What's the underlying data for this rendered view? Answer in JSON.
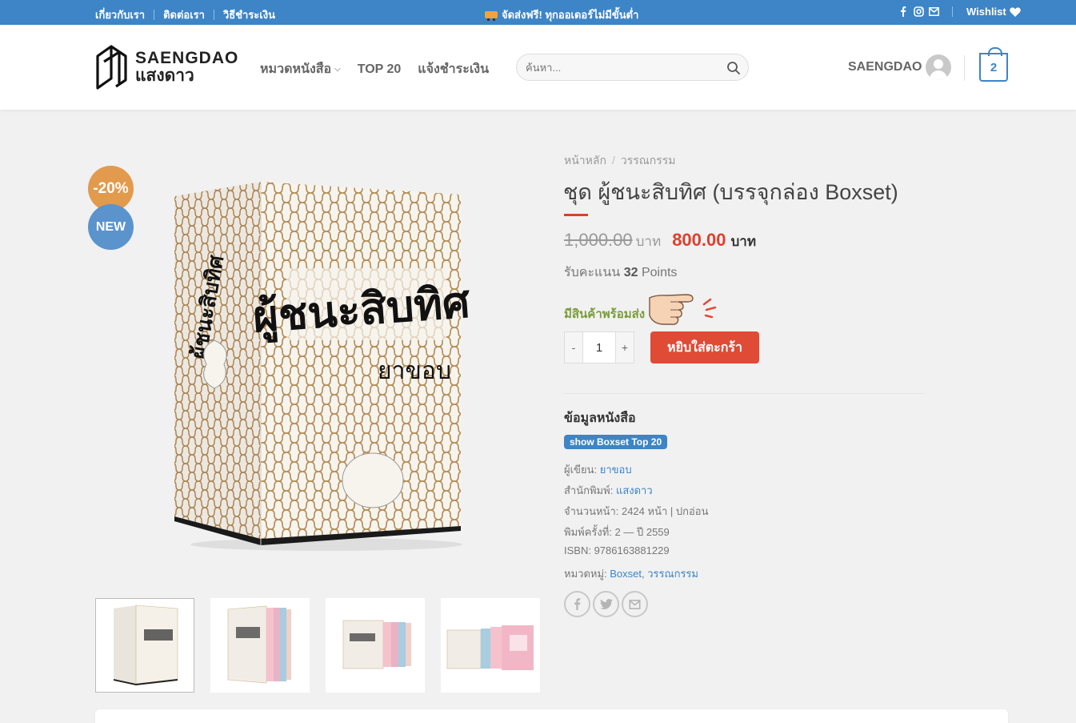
{
  "topbar": {
    "links": [
      "เกี่ยวกับเรา",
      "ติดต่อเรา",
      "วิธีชำระเงิน"
    ],
    "promo": "จัดส่งฟรี! ทุกออเดอร์ไม่มีขั้นต่ำ",
    "wishlist": "Wishlist"
  },
  "header": {
    "logo_en": "SAENGDAO",
    "logo_th": "แสงดาว",
    "nav": [
      "หมวดหนังสือ",
      "TOP 20",
      "แจ้งชำระเงิน"
    ],
    "search_placeholder": "ค้นหา...",
    "account": "SAENGDAO",
    "cart_count": "2"
  },
  "badges": {
    "sale": "-20%",
    "new": "NEW"
  },
  "product": {
    "breadcrumb": [
      "หน้าหลัก",
      "วรรณกรรม"
    ],
    "title": "ชุด ผู้ชนะสิบทิศ (บรรจุกล่อง Boxset)",
    "old_price": "1,000.00",
    "currency": "บาท",
    "new_price": "800.00",
    "points_prefix": "รับคะแนน",
    "points_value": "32",
    "points_suffix": "Points",
    "stock": "มีสินค้าพร้อมส่ง",
    "qty_minus": "-",
    "qty": "1",
    "qty_plus": "+",
    "add_to_cart": "หยิบใส่ตะกร้า",
    "info_title": "ข้อมูลหนังสือ",
    "tag": "show Boxset Top 20",
    "author_label": "ผู้เขียน:",
    "author": "ยาขอบ",
    "publisher_label": "สำนักพิมพ์:",
    "publisher": "แสงดาว",
    "pages": "จำนวนหน้า: 2424 หน้า | ปกอ่อน",
    "edition": "พิมพ์ครั้งที่: 2 — ปี 2559",
    "isbn": "ISBN: 9786163881229",
    "category_label": "หมวดหมู่:",
    "categories": [
      "Boxset",
      "วรรณกรรม"
    ],
    "cover_title": "ผู้ชนะสิบทิศ",
    "cover_author": "ยาขอบ"
  },
  "colors": {
    "accent": "#3d85c6",
    "sale": "#e29a4d",
    "price": "#e03e2d",
    "stock": "#7a9c3a"
  }
}
